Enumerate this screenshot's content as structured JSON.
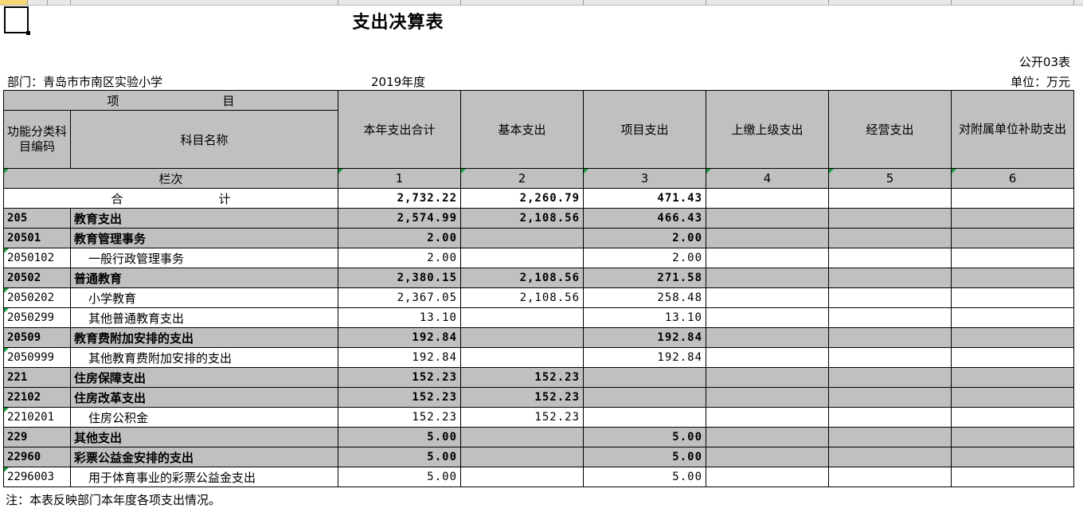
{
  "title": "支出决算表",
  "table_no": "公开03表",
  "dept": "部门：青岛市市南区实验小学",
  "year": "2019年度",
  "unit": "单位：万元",
  "note": "注：本表反映部门本年度各项支出情况。",
  "header": {
    "item_left": "项",
    "item_right": "目",
    "code_col": "功能分类科目编码",
    "name_col": "科目名称",
    "columns": [
      "本年支出合计",
      "基本支出",
      "项目支出",
      "上缴上级支出",
      "经营支出",
      "对附属单位补助支出"
    ],
    "lanci": "栏次",
    "col_nums": [
      "1",
      "2",
      "3",
      "4",
      "5",
      "6"
    ],
    "total_left": "合",
    "total_right": "计"
  },
  "total": {
    "values": [
      "2,732.22",
      "2,260.79",
      "471.43",
      "",
      "",
      ""
    ]
  },
  "rows": [
    {
      "code": "205",
      "name": "教育支出",
      "level": "g",
      "values": [
        "2,574.99",
        "2,108.56",
        "466.43",
        "",
        "",
        ""
      ]
    },
    {
      "code": "20501",
      "name": "教育管理事务",
      "level": "g",
      "values": [
        "2.00",
        "",
        "2.00",
        "",
        "",
        ""
      ]
    },
    {
      "code": "2050102",
      "name": "一般行政管理事务",
      "level": "w",
      "values": [
        "2.00",
        "",
        "2.00",
        "",
        "",
        ""
      ]
    },
    {
      "code": "20502",
      "name": "普通教育",
      "level": "g",
      "values": [
        "2,380.15",
        "2,108.56",
        "271.58",
        "",
        "",
        ""
      ]
    },
    {
      "code": "2050202",
      "name": "小学教育",
      "level": "w",
      "values": [
        "2,367.05",
        "2,108.56",
        "258.48",
        "",
        "",
        ""
      ]
    },
    {
      "code": "2050299",
      "name": "其他普通教育支出",
      "level": "w",
      "values": [
        "13.10",
        "",
        "13.10",
        "",
        "",
        ""
      ]
    },
    {
      "code": "20509",
      "name": "教育费附加安排的支出",
      "level": "g",
      "values": [
        "192.84",
        "",
        "192.84",
        "",
        "",
        ""
      ]
    },
    {
      "code": "2050999",
      "name": "其他教育费附加安排的支出",
      "level": "w",
      "values": [
        "192.84",
        "",
        "192.84",
        "",
        "",
        ""
      ]
    },
    {
      "code": "221",
      "name": "住房保障支出",
      "level": "g",
      "values": [
        "152.23",
        "152.23",
        "",
        "",
        "",
        ""
      ]
    },
    {
      "code": "22102",
      "name": "住房改革支出",
      "level": "g",
      "values": [
        "152.23",
        "152.23",
        "",
        "",
        "",
        ""
      ]
    },
    {
      "code": "2210201",
      "name": "住房公积金",
      "level": "w",
      "values": [
        "152.23",
        "152.23",
        "",
        "",
        "",
        ""
      ]
    },
    {
      "code": "229",
      "name": "其他支出",
      "level": "g",
      "values": [
        "5.00",
        "",
        "5.00",
        "",
        "",
        ""
      ]
    },
    {
      "code": "22960",
      "name": "彩票公益金安排的支出",
      "level": "g",
      "values": [
        "5.00",
        "",
        "5.00",
        "",
        "",
        ""
      ]
    },
    {
      "code": "2296003",
      "name": "用于体育事业的彩票公益金支出",
      "level": "w",
      "values": [
        "5.00",
        "",
        "5.00",
        "",
        "",
        ""
      ]
    }
  ],
  "colors": {
    "header_gray": "#c0c0c0",
    "detail_cyan": "#ccffff",
    "marker_green": "#1a9b3c"
  }
}
